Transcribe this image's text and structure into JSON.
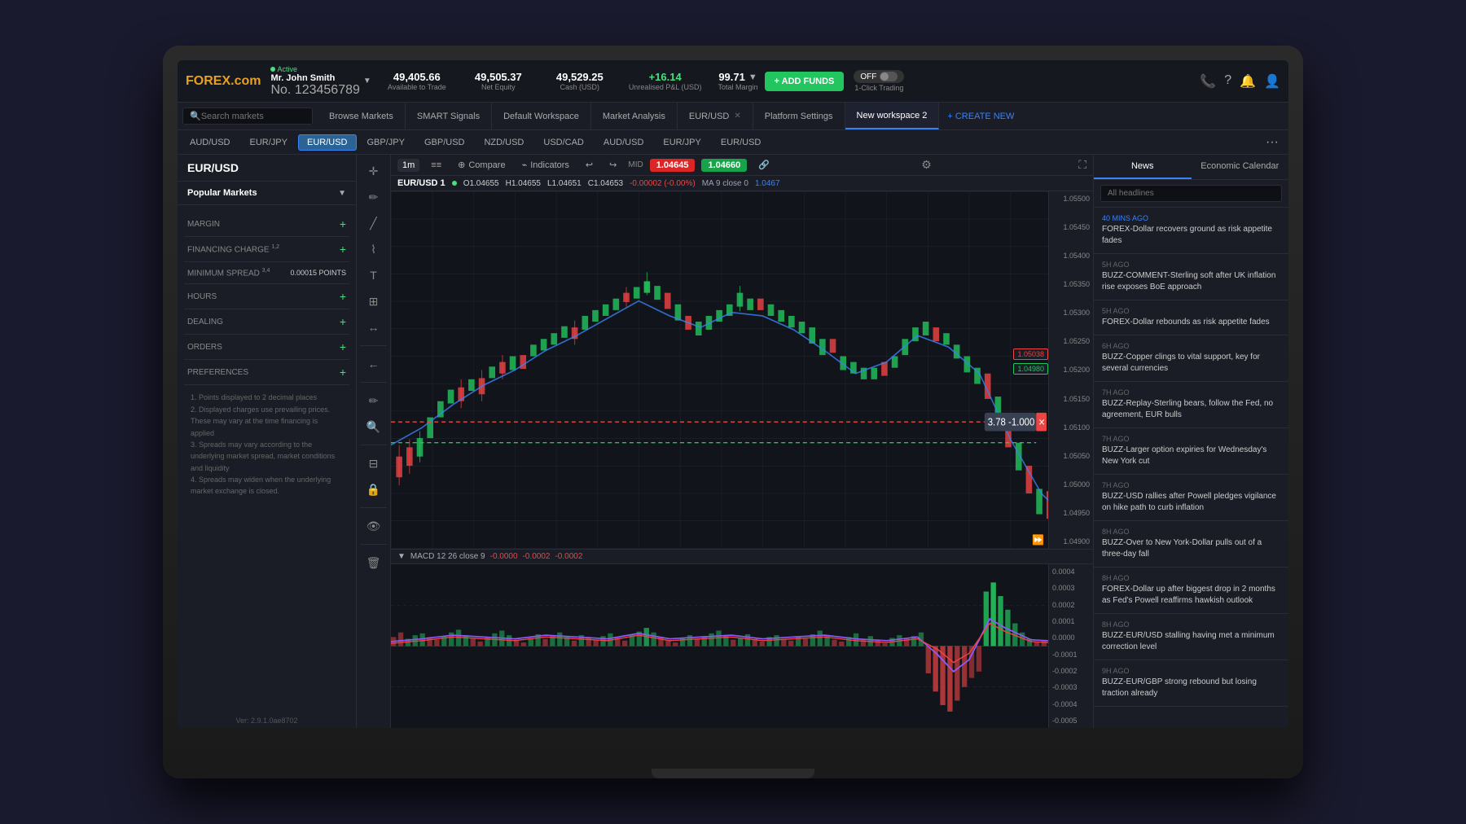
{
  "app": {
    "title": "FOREX.com",
    "logo_text": "FOREX",
    "logo_domain": ".com"
  },
  "account": {
    "status": "Active",
    "name": "Mr. John Smith",
    "number": "No. 123456789",
    "available_to_trade": "49,405.66",
    "available_label": "Available to Trade",
    "net_equity": "49,505.37",
    "net_equity_label": "Net Equity",
    "cash": "49,529.25",
    "cash_label": "Cash (USD)",
    "pnl": "+16.14",
    "pnl_label": "Unrealised P&L (USD)",
    "margin": "99.71",
    "margin_label": "Total Margin",
    "add_funds_label": "+ ADD FUNDS",
    "one_click_label": "1-Click Trading",
    "toggle_label": "OFF"
  },
  "tabs": {
    "search_placeholder": "Search markets",
    "items": [
      {
        "label": "Browse Markets",
        "active": false,
        "closeable": false
      },
      {
        "label": "SMART Signals",
        "active": false,
        "closeable": false
      },
      {
        "label": "Default Workspace",
        "active": false,
        "closeable": false
      },
      {
        "label": "Market Analysis",
        "active": false,
        "closeable": false
      },
      {
        "label": "EUR/USD",
        "active": false,
        "closeable": true
      },
      {
        "label": "Platform Settings",
        "active": false,
        "closeable": false
      },
      {
        "label": "New workspace 2",
        "active": true,
        "closeable": false
      }
    ],
    "create_new": "+ CREATE NEW"
  },
  "instrument_tabs": [
    {
      "label": "AUD/USD",
      "active": false
    },
    {
      "label": "EUR/JPY",
      "active": false
    },
    {
      "label": "EUR/USD",
      "active": true
    },
    {
      "label": "GBP/JPY",
      "active": false
    },
    {
      "label": "GBP/USD",
      "active": false
    },
    {
      "label": "NZD/USD",
      "active": false
    },
    {
      "label": "USD/CAD",
      "active": false
    },
    {
      "label": "AUD/USD",
      "active": false
    },
    {
      "label": "EUR/JPY",
      "active": false
    },
    {
      "label": "EUR/USD",
      "active": false
    }
  ],
  "market": {
    "pair": "EUR/USD",
    "selector": "Popular Markets",
    "sections": [
      {
        "label": "MARGIN",
        "value": "",
        "expandable": true
      },
      {
        "label": "FINANCING CHARGE",
        "sup": "1,2",
        "value": "",
        "expandable": true
      },
      {
        "label": "MINIMUM SPREAD",
        "sup": "3,4",
        "value": "0.00015 POINTS",
        "expandable": false
      },
      {
        "label": "HOURS",
        "value": "",
        "expandable": true
      },
      {
        "label": "DEALING",
        "value": "",
        "expandable": true
      },
      {
        "label": "ORDERS",
        "value": "",
        "expandable": true
      },
      {
        "label": "PREFERENCES",
        "value": "",
        "expandable": true
      }
    ],
    "footnotes": [
      "1. Points displayed to 2 decimal places",
      "2. Displayed charges use prevailing prices. These may vary at the time financing is applied",
      "3. Spreads may vary according to the underlying market spread, market conditions and liquidity",
      "4. Spreads may widen when the underlying market exchange is closed."
    ],
    "version": "Ver: 2.9.1.0ae8702"
  },
  "chart": {
    "timeframe": "1m",
    "compare_label": "Compare",
    "indicators_label": "Indicators",
    "mid_label": "MID",
    "sell_price": "1.04645",
    "buy_price": "1.04660",
    "pair": "EUR/USD 1",
    "open": "O1.04655",
    "high": "H1.04655",
    "low": "L1.04651",
    "close": "C1.04653",
    "change": "-0.00002 (-0.00%)",
    "ma_label": "MA 9 close 0",
    "ma_value": "1.0467",
    "price_levels": [
      "1.05500",
      "1.05450",
      "1.05400",
      "1.05350",
      "1.05300",
      "1.05250",
      "1.05200",
      "1.05150",
      "1.05100",
      "1.05050",
      "1.05000",
      "1.04950",
      "1.04900"
    ],
    "sell_line": "1.05038",
    "buy_line": "1.04980",
    "crosshair_value": "3.78  -1.000"
  },
  "macd": {
    "label": "MACD 12 26 close 9",
    "val1": "-0.0000",
    "val2": "-0.0002",
    "val3": "-0.0002",
    "levels": [
      "0.0004",
      "0.0003",
      "0.0002",
      "0.0001",
      "0.0000",
      "-0.0001",
      "-0.0002",
      "-0.0003",
      "-0.0004",
      "-0.0005"
    ]
  },
  "news": {
    "tabs": [
      "News",
      "Economic Calendar"
    ],
    "active_tab": "News",
    "search_placeholder": "All headlines",
    "items": [
      {
        "time": "40 MINS AGO",
        "source": "FOREX",
        "title": "FOREX-Dollar recovers ground as risk appetite fades"
      },
      {
        "time": "5H AGO",
        "source": "BUZZ",
        "title": "BUZZ-COMMENT-Sterling soft after UK inflation rise exposes BoE approach"
      },
      {
        "time": "5H AGO",
        "source": "FOREX",
        "title": "FOREX-Dollar rebounds as risk appetite fades"
      },
      {
        "time": "6H AGO",
        "source": "BUZZ",
        "title": "BUZZ-Copper clings to vital support, key for several currencies"
      },
      {
        "time": "7H AGO",
        "source": "BUZZ",
        "title": "BUZZ-Replay-Sterling bears, follow the Fed, no agreement, EUR bulls"
      },
      {
        "time": "7H AGO",
        "source": "BUZZ",
        "title": "BUZZ-Larger option expiries for Wednesday's New York cut"
      },
      {
        "time": "7H AGO",
        "source": "BUZZ",
        "title": "BUZZ-USD rallies after Powell pledges vigilance on hike path to curb inflation"
      },
      {
        "time": "8H AGO",
        "source": "BUZZ",
        "title": "BUZZ-Over to New York-Dollar pulls out of a three-day fall"
      },
      {
        "time": "8H AGO",
        "source": "FOREX",
        "title": "FOREX-Dollar up after biggest drop in 2 months as Fed's Powell reaffirms hawkish outlook"
      },
      {
        "time": "8H AGO",
        "source": "BUZZ",
        "title": "BUZZ-EUR/USD stalling having met a minimum correction level"
      },
      {
        "time": "9H AGO",
        "source": "BUZZ",
        "title": "BUZZ-EUR/GBP strong rebound but losing traction already"
      }
    ]
  }
}
